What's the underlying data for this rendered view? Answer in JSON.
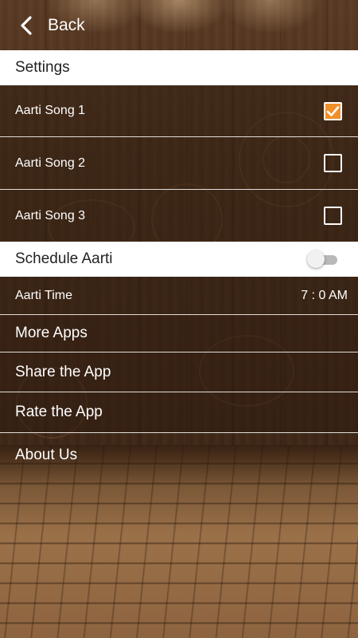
{
  "header": {
    "back_label": "Back",
    "back_icon": "chevron-left-icon"
  },
  "settings": {
    "section_title": "Settings",
    "songs": [
      {
        "label": "Aarti Song 1",
        "checked": true
      },
      {
        "label": "Aarti Song 2",
        "checked": false
      },
      {
        "label": "Aarti Song 3",
        "checked": false
      }
    ],
    "checkbox_accent_color": "#f0902a"
  },
  "schedule": {
    "title": "Schedule Aarti",
    "enabled": false,
    "time_label": "Aarti Time",
    "time_value": "7 : 0 AM"
  },
  "menu": {
    "items": [
      {
        "label": "More Apps"
      },
      {
        "label": "Share the App"
      },
      {
        "label": "Rate the App"
      },
      {
        "label": "About Us"
      }
    ]
  }
}
